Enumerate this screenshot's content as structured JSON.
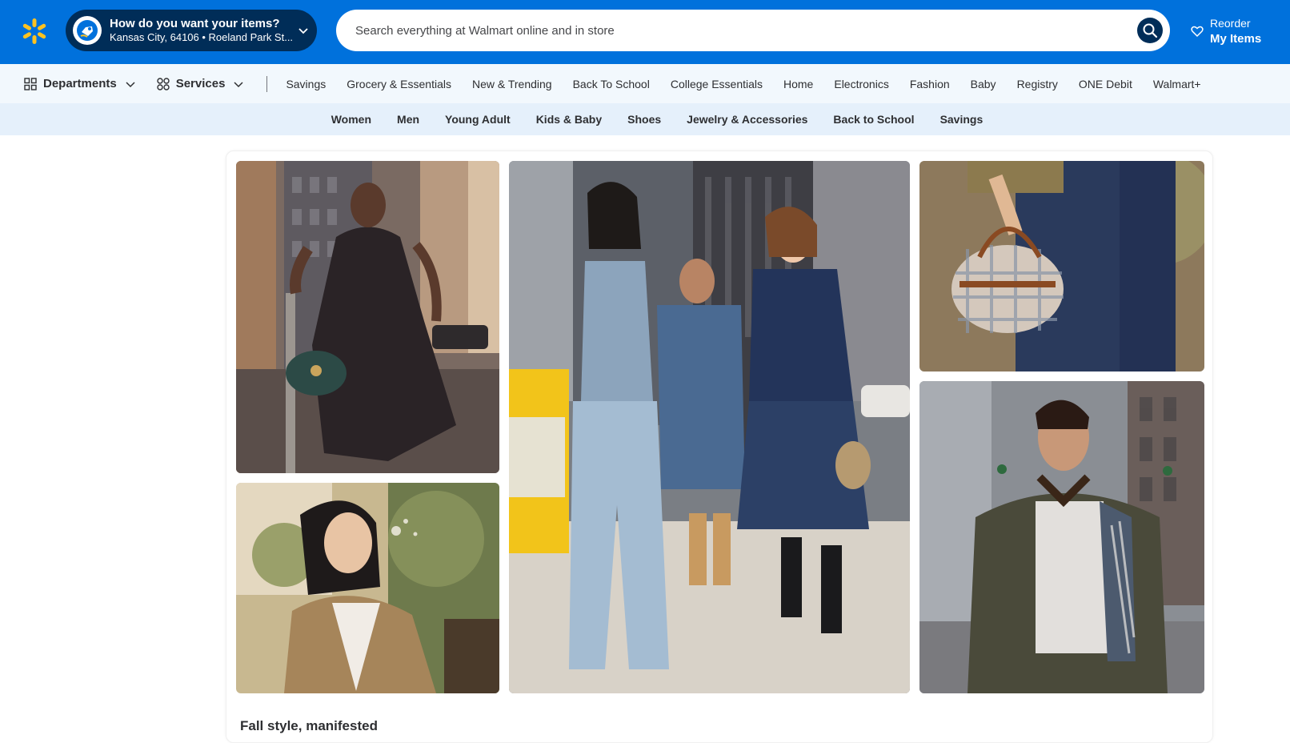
{
  "header": {
    "location_title": "How do you want your items?",
    "location_subtitle": "Kansas City, 64106 • Roeland Park St...",
    "search_placeholder": "Search everything at Walmart online and in store",
    "reorder_top": "Reorder",
    "reorder_bottom": "My Items"
  },
  "nav": {
    "departments_label": "Departments",
    "services_label": "Services",
    "links": [
      "Savings",
      "Grocery & Essentials",
      "New & Trending",
      "Back To School",
      "College Essentials",
      "Home",
      "Electronics",
      "Fashion",
      "Baby",
      "Registry",
      "ONE Debit",
      "Walmart+"
    ]
  },
  "subnav": {
    "links": [
      "Women",
      "Men",
      "Young Adult",
      "Kids & Baby",
      "Shoes",
      "Jewelry & Accessories",
      "Back to School",
      "Savings"
    ]
  },
  "content": {
    "caption": "Fall style, manifested"
  },
  "colors": {
    "brand_blue": "#0071dc",
    "brand_navy": "#002d58",
    "spark_yellow": "#ffc220",
    "nav_bg": "#f2f8fd",
    "subnav_bg": "#e5f0fb"
  },
  "icons": {
    "logo": "walmart-spark-icon",
    "location": "delivery-location-icon",
    "search": "search-icon",
    "reorder": "heart-icon",
    "departments": "grid-icon",
    "services": "services-grid-icon"
  }
}
